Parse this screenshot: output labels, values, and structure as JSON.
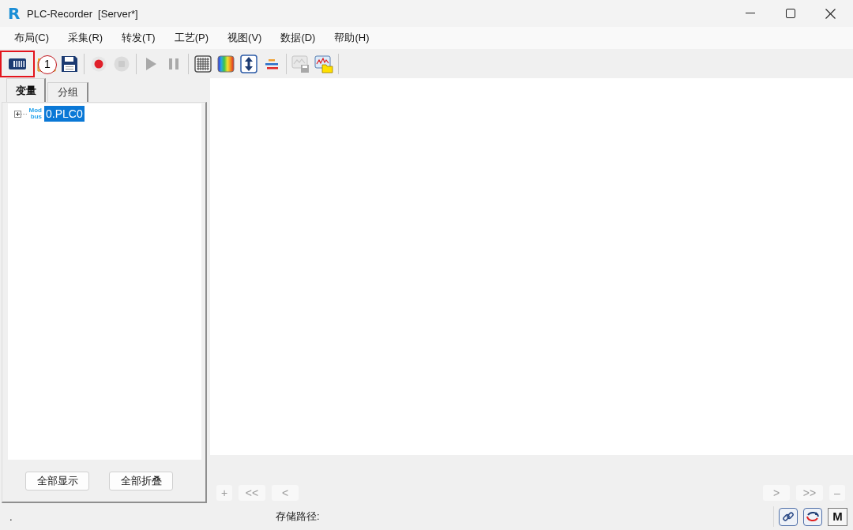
{
  "window": {
    "logo": "R",
    "title": "PLC-Recorder",
    "subtitle": "[Server*]"
  },
  "menu": [
    "布局(C)",
    "采集(R)",
    "转发(T)",
    "工艺(P)",
    "视图(V)",
    "数据(D)",
    "帮助(H)"
  ],
  "toolbar": {
    "callout": "1",
    "groups": [
      [
        {
          "disabled": false,
          "highlighted": true
        },
        {
          "disabled": false,
          "highlighted": false
        },
        {
          "disabled": false,
          "highlighted": false
        }
      ],
      [
        {
          "disabled": false,
          "highlighted": false
        },
        {
          "disabled": true,
          "highlighted": false
        }
      ],
      [
        {
          "disabled": true,
          "highlighted": false
        },
        {
          "disabled": true,
          "highlighted": false
        }
      ],
      [
        {
          "disabled": false,
          "highlighted": false
        },
        {
          "disabled": false,
          "highlighted": false
        },
        {
          "disabled": false,
          "highlighted": false
        },
        {
          "disabled": false,
          "highlighted": false
        }
      ],
      [
        {
          "disabled": true,
          "highlighted": false
        },
        {
          "disabled": false,
          "highlighted": false
        }
      ]
    ]
  },
  "panel": {
    "tabs": [
      {
        "label": "变量",
        "selected": true
      },
      {
        "label": "分组",
        "selected": false
      }
    ],
    "tree": [
      {
        "protocol": [
          "Mod",
          "bus"
        ],
        "label": "0.PLC0",
        "expanded": false,
        "selected": true
      }
    ],
    "buttons": [
      "全部显示",
      "全部折叠"
    ]
  },
  "navigator": {
    "left": [
      {
        "label": "+",
        "disabled": true
      },
      {
        "label": "<<",
        "disabled": true
      },
      {
        "label": "<",
        "disabled": true
      }
    ],
    "right": [
      {
        "label": ">",
        "disabled": true
      },
      {
        "label": ">>",
        "disabled": true
      },
      {
        "label": "–",
        "disabled": true
      }
    ]
  },
  "status_bar": {
    "message": ".",
    "storage_label": "存储路径:",
    "mode_button": "M"
  }
}
